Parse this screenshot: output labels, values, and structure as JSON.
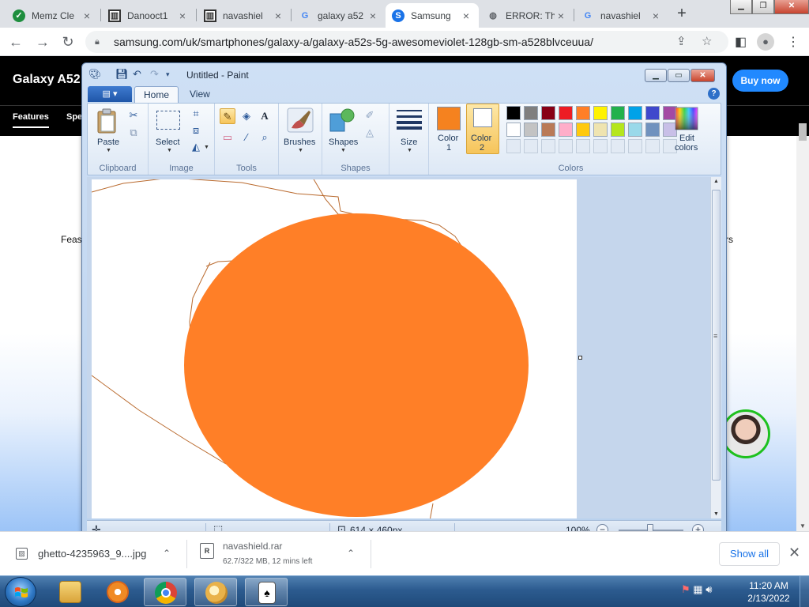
{
  "browser": {
    "tabs": [
      {
        "title": "Memz Cle",
        "icon": "check-circle-icon"
      },
      {
        "title": "Danooct1",
        "icon": "museum-icon"
      },
      {
        "title": "navashiel",
        "icon": "museum-icon"
      },
      {
        "title": "galaxy a52",
        "icon": "google-icon"
      },
      {
        "title": "Samsung",
        "icon": "samsung-icon",
        "active": true
      },
      {
        "title": "ERROR: Th",
        "icon": "globe-icon"
      },
      {
        "title": "navashiel",
        "icon": "google-icon"
      }
    ],
    "url": "samsung.com/uk/smartphones/galaxy-a/galaxy-a52s-5g-awesomeviolet-128gb-sm-a528blvceuua/"
  },
  "site": {
    "title": "Galaxy A52",
    "buy_label": "Buy now",
    "nav": [
      "Features",
      "Spe"
    ],
    "text_left": "Feas",
    "text_right": "rs"
  },
  "paint": {
    "window_title": "Untitled - Paint",
    "tabs": {
      "home": "Home",
      "view": "View"
    },
    "groups": {
      "clipboard": "Clipboard",
      "image": "Image",
      "tools": "Tools",
      "shapes": "Shapes",
      "colors": "Colors"
    },
    "buttons": {
      "paste": "Paste",
      "select": "Select",
      "brushes": "Brushes",
      "shapes": "Shapes",
      "size": "Size",
      "color1_l1": "Color",
      "color1_l2": "1",
      "color2_l1": "Color",
      "color2_l2": "2",
      "edit_l1": "Edit",
      "edit_l2": "colors"
    },
    "color1": "#f5821f",
    "color2": "#ffffff",
    "palette_row1": [
      "#000000",
      "#7f7f7f",
      "#880015",
      "#ed1c24",
      "#ff7f27",
      "#fff200",
      "#22b14c",
      "#00a2e8",
      "#3f48cc",
      "#a349a4"
    ],
    "palette_row2": [
      "#ffffff",
      "#c3c3c3",
      "#b97a57",
      "#ffaec9",
      "#ffc90e",
      "#efe4b0",
      "#b5e61d",
      "#99d9ea",
      "#7092be",
      "#c8bfe7"
    ],
    "fill_color": "#ff7f27",
    "stroke_color": "#b96a2e",
    "status": {
      "canvas_size": "614 × 460px",
      "zoom": "100%"
    }
  },
  "downloads": [
    {
      "name": "ghetto-4235963_9....jpg",
      "icon": "image-file-icon"
    },
    {
      "name": "navashield.rar",
      "progress": "62.7/322 MB, 12 mins left",
      "icon": "rar-file-icon"
    }
  ],
  "shelf": {
    "show_all": "Show all"
  },
  "taskbar": {
    "time": "11:20 AM",
    "date": "2/13/2022"
  }
}
